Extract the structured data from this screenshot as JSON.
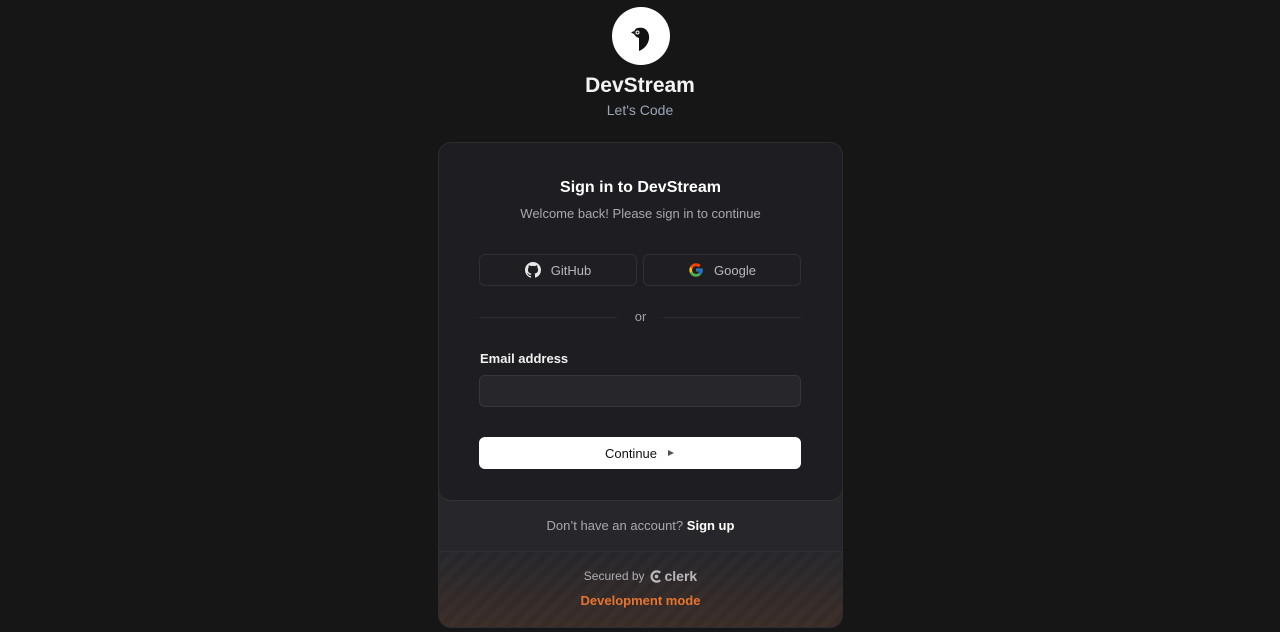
{
  "brand": {
    "title": "DevStream",
    "tagline": "Let's Code",
    "logo_icon": "bird-logo"
  },
  "card": {
    "title": "Sign in to DevStream",
    "subtitle": "Welcome back! Please sign in to continue",
    "social": [
      {
        "label": "GitHub",
        "icon": "github-icon"
      },
      {
        "label": "Google",
        "icon": "google-icon"
      }
    ],
    "divider_text": "or",
    "email_label": "Email address",
    "email_value": "",
    "continue_label": "Continue",
    "continue_icon": "triangle-right-icon"
  },
  "footer": {
    "signup_prompt": "Don’t have an account?",
    "signup_link": "Sign up",
    "secured_by": "Secured by",
    "provider": "clerk",
    "dev_mode": "Development mode"
  },
  "colors": {
    "background": "#161616",
    "card": "#1e1e22",
    "accent_dev_mode": "#e8742e"
  }
}
